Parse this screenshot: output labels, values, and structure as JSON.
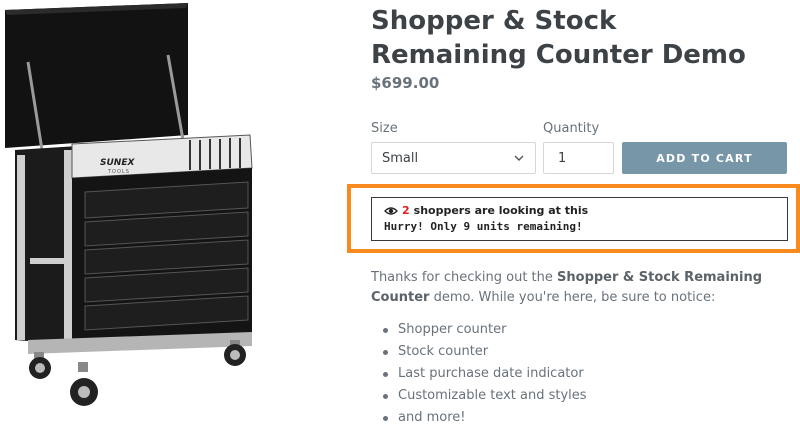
{
  "product": {
    "title": "Shopper & Stock Remaining Counter Demo",
    "price": "$699.00",
    "brand_mark": "SUNEX",
    "brand_sub": "TOOLS"
  },
  "form": {
    "size_label": "Size",
    "size_value": "Small",
    "quantity_label": "Quantity",
    "quantity_value": "1",
    "add_to_cart_label": "ADD TO CART"
  },
  "counter": {
    "shopper_count": "2",
    "shopper_text": "shoppers are looking at this",
    "stock_text": "Hurry! Only 9 units remaining!",
    "highlight_color": "#f88a1e",
    "count_color": "#e02020"
  },
  "description": {
    "intro": "Thanks for checking out the ",
    "product_name": "Shopper & Stock Remaining Counter",
    "outro": " demo. While you're here, be sure to notice:",
    "features": [
      "Shopper counter",
      "Stock counter",
      "Last purchase date indicator",
      "Customizable text and styles",
      "and more!"
    ]
  },
  "colors": {
    "button": "#7796a8",
    "title": "#3d4246",
    "muted": "#69727b"
  }
}
